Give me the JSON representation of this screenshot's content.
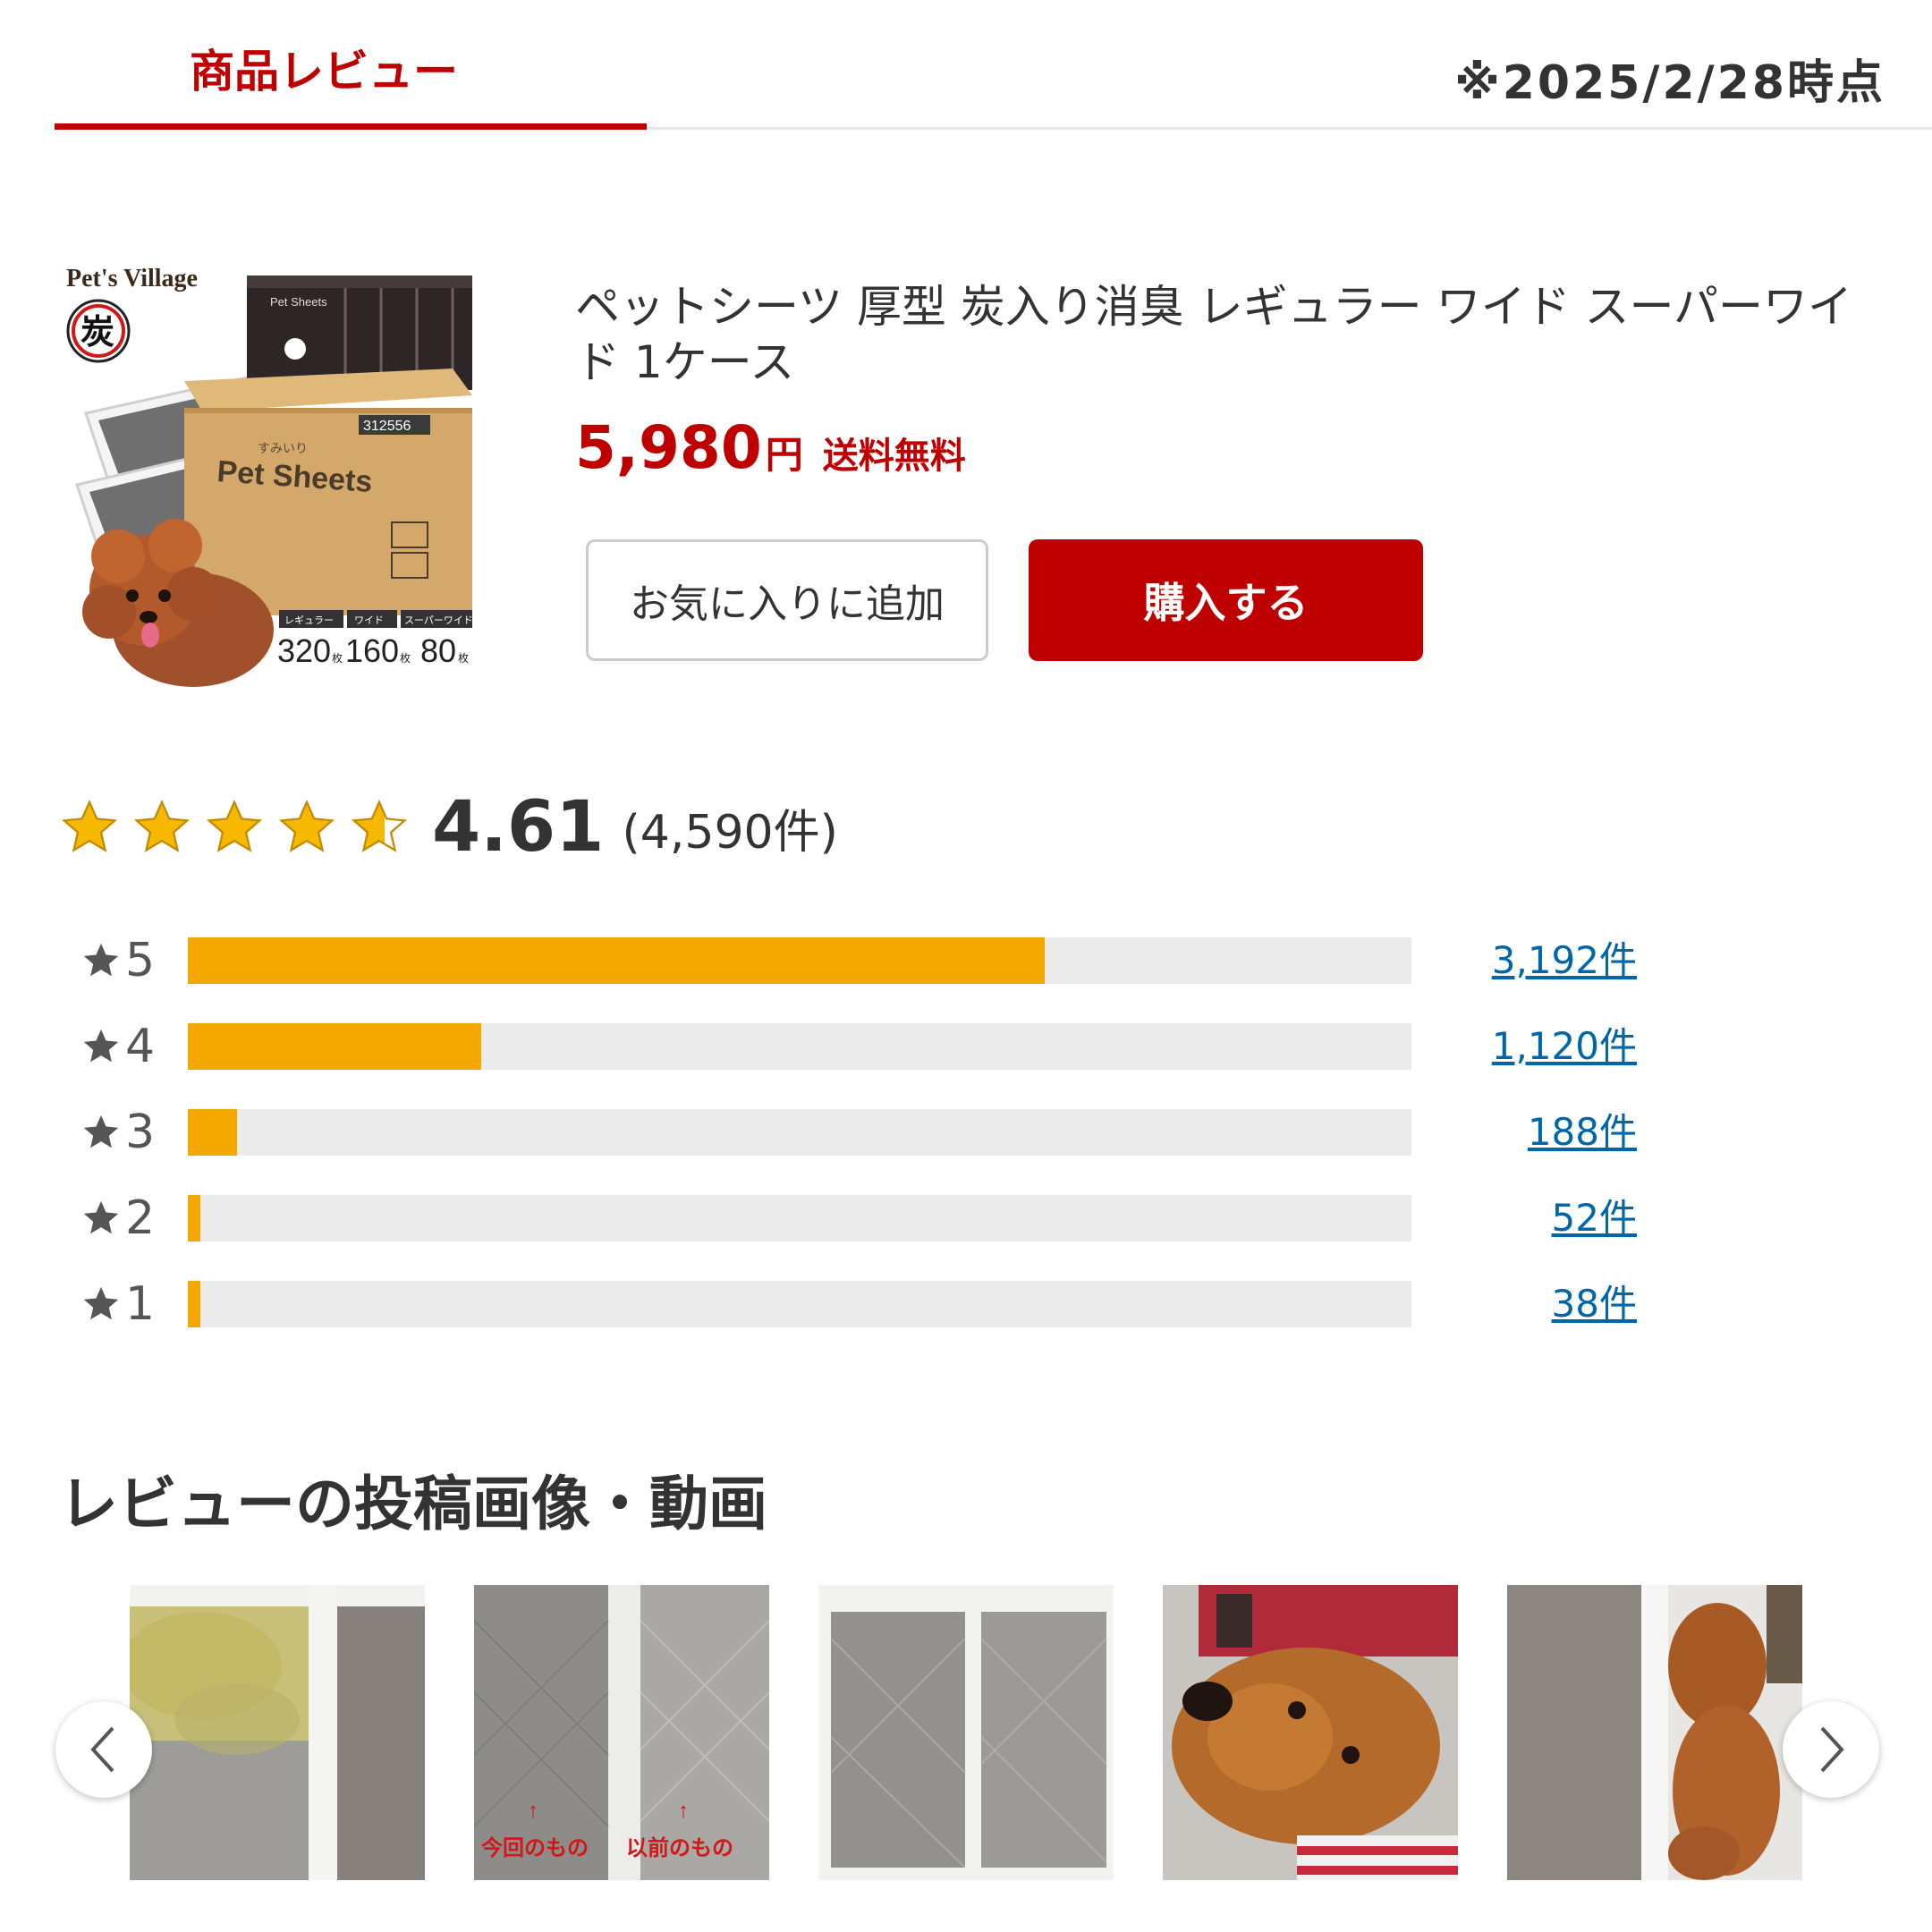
{
  "tab": {
    "label": "商品レビュー",
    "as_of": "※2025/2/28時点"
  },
  "product": {
    "title": "ペットシーツ 厚型 炭入り消臭 レギュラー ワイド スーパーワイド 1ケース",
    "price": "5,980",
    "price_unit": "円",
    "shipping": "送料無料",
    "image": {
      "brand": "Pet's Village",
      "badge_char": "炭",
      "box_label": "Pet Sheets",
      "box_small": "すみいり",
      "box_code": "312556",
      "dark_box_label": "Pet Sheets",
      "size_labels": [
        "レギュラー",
        "ワイド",
        "スーパーワイド"
      ],
      "counts": [
        "320",
        "160",
        "80"
      ],
      "count_unit": "枚"
    },
    "buttons": {
      "favorite": "お気に入りに追加",
      "buy": "購入する"
    }
  },
  "rating": {
    "average": "4.61",
    "average_value": 4.61,
    "total": "(4,590件)",
    "distribution": [
      {
        "stars": "5",
        "count": "3,192件",
        "ratio": 0.7
      },
      {
        "stars": "4",
        "count": "1,120件",
        "ratio": 0.24
      },
      {
        "stars": "3",
        "count": "188件",
        "ratio": 0.04
      },
      {
        "stars": "2",
        "count": "52件",
        "ratio": 0.01
      },
      {
        "stars": "1",
        "count": "38件",
        "ratio": 0.01
      }
    ]
  },
  "media": {
    "heading": "レビューの投稿画像・動画",
    "thumb2_labels": {
      "left": "今回のもの",
      "right": "以前のもの",
      "arrow": "↑"
    },
    "prev_icon": "chevron-left-icon",
    "next_icon": "chevron-right-icon"
  },
  "colors": {
    "accent": "#bf0000",
    "bar_fill": "#f5a800",
    "bar_track": "#ebebeb",
    "link": "#0066aa",
    "star": "#f7b800"
  }
}
